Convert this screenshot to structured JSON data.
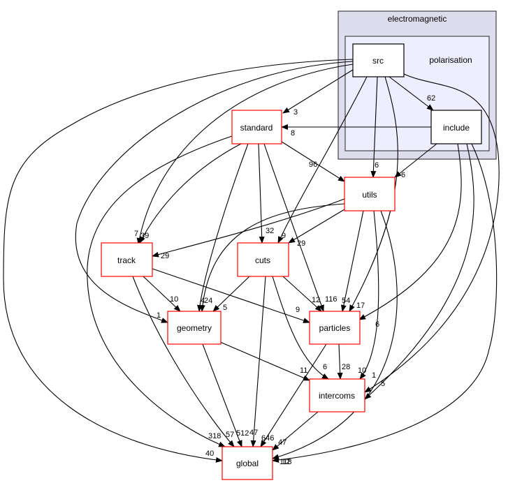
{
  "clusters": {
    "outer": {
      "label": "electromagnetic",
      "fill": "#ddddee"
    },
    "inner": {
      "label": "polarisation",
      "fill": "#eeeeff"
    }
  },
  "nodes": {
    "src": "src",
    "include": "include",
    "standard": "standard",
    "utils": "utils",
    "track": "track",
    "cuts": "cuts",
    "geometry": "geometry",
    "particles": "particles",
    "intercoms": "intercoms",
    "global": "global"
  },
  "colors": {
    "external_node_border": "#ff0000",
    "internal_node_border": "#000000"
  },
  "edges": [
    {
      "from": "src",
      "to": "standard",
      "label": "3"
    },
    {
      "from": "src",
      "to": "include",
      "label": "62"
    },
    {
      "from": "src",
      "to": "utils",
      "label": "6"
    },
    {
      "from": "src",
      "to": "cuts",
      "label": "9"
    },
    {
      "from": "src",
      "to": "particles",
      "label": "17"
    },
    {
      "from": "src",
      "to": "track",
      "label": "7"
    },
    {
      "from": "src",
      "to": "geometry",
      "label": "1"
    },
    {
      "from": "src",
      "to": "global",
      "label": "40"
    },
    {
      "from": "src",
      "to": "intercoms",
      "label": "1"
    },
    {
      "from": "include",
      "to": "standard",
      "label": "8"
    },
    {
      "from": "include",
      "to": "utils",
      "label": "6"
    },
    {
      "from": "include",
      "to": "particles",
      "label": "6"
    },
    {
      "from": "include",
      "to": "intercoms",
      "label": "5"
    },
    {
      "from": "include",
      "to": "global",
      "label": "118"
    },
    {
      "from": "standard",
      "to": "utils",
      "label": "96"
    },
    {
      "from": "standard",
      "to": "track",
      "label": "39"
    },
    {
      "from": "standard",
      "to": "cuts",
      "label": "32"
    },
    {
      "from": "standard",
      "to": "particles",
      "label": "116"
    },
    {
      "from": "standard",
      "to": "geometry",
      "label": "24"
    },
    {
      "from": "standard",
      "to": "global",
      "label": "318"
    },
    {
      "from": "utils",
      "to": "track",
      "label": "29"
    },
    {
      "from": "utils",
      "to": "cuts",
      "label": "29"
    },
    {
      "from": "utils",
      "to": "geometry",
      "label": "4"
    },
    {
      "from": "utils",
      "to": "particles",
      "label": "54"
    },
    {
      "from": "utils",
      "to": "intercoms",
      "label": "10"
    },
    {
      "from": "utils",
      "to": "global",
      "label": "12"
    },
    {
      "from": "track",
      "to": "geometry",
      "label": "10"
    },
    {
      "from": "track",
      "to": "particles",
      "label": "9"
    },
    {
      "from": "track",
      "to": "global",
      "label": "57"
    },
    {
      "from": "cuts",
      "to": "geometry",
      "label": "5"
    },
    {
      "from": "cuts",
      "to": "particles",
      "label": "12"
    },
    {
      "from": "cuts",
      "to": "intercoms",
      "label": "6"
    },
    {
      "from": "cuts",
      "to": "global",
      "label": "47"
    },
    {
      "from": "geometry",
      "to": "global",
      "label": "512"
    },
    {
      "from": "geometry",
      "to": "intercoms",
      "label": "11"
    },
    {
      "from": "particles",
      "to": "intercoms",
      "label": "28"
    },
    {
      "from": "particles",
      "to": "global",
      "label": "646"
    },
    {
      "from": "intercoms",
      "to": "global",
      "label": "47"
    }
  ]
}
